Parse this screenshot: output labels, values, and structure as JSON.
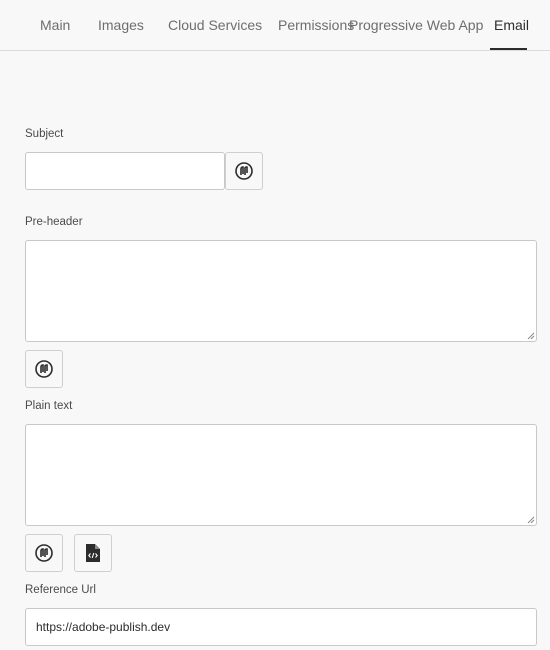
{
  "tabs": [
    {
      "label": "Main"
    },
    {
      "label": "Images"
    },
    {
      "label": "Cloud Services"
    },
    {
      "label": "Permissions"
    },
    {
      "label": "Progressive Web App"
    },
    {
      "label": "Email",
      "active": true
    }
  ],
  "form": {
    "subject": {
      "label": "Subject",
      "value": ""
    },
    "preheader": {
      "label": "Pre-header",
      "value": ""
    },
    "plaintext": {
      "label": "Plain text",
      "value": ""
    },
    "reference_url": {
      "label": "Reference Url",
      "value": "https://adobe-publish.dev"
    }
  },
  "icons": {
    "variable_picker": "variable-picker-icon",
    "file_code": "file-code-icon"
  }
}
